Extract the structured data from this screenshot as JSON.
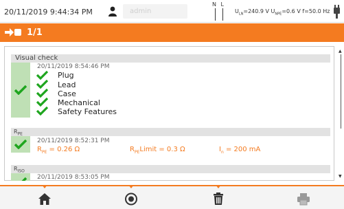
{
  "status": {
    "datetime": "20/11/2019 9:44:34 PM",
    "user_placeholder": "admin",
    "phase_labels": "N L",
    "voltage_html": "U<sub>LN</sub>=240.9 V U<sub>NPE</sub>=0.6 V f=50.0 Hz",
    "icons": {
      "user": "user-icon",
      "plug": "plug-icon"
    }
  },
  "titlebar": {
    "page": "1/1",
    "icon": "meter-probe-icon"
  },
  "sections": {
    "visual": {
      "title": "Visual check",
      "timestamp": "20/11/2019 8:54:46 PM",
      "items": [
        "Plug",
        "Lead",
        "Case",
        "Mechanical",
        "Safety Features"
      ]
    },
    "rpe": {
      "symbol_main": "R",
      "symbol_sub": "PE",
      "timestamp": "20/11/2019 8:52:31 PM",
      "value_label": "R",
      "value_sub": "PE",
      "value_text": " = 0.26 Ω",
      "limit_label": "R",
      "limit_sub": "PE",
      "limit_text": "Limit = 0.3 Ω",
      "current_label": "I",
      "current_sub": "n",
      "current_text": " = 200 mA"
    },
    "riso": {
      "symbol_main": "R",
      "symbol_sub": "ISO",
      "timestamp": "20/11/2019 8:53:05 PM"
    }
  },
  "bottombar": {
    "buttons": [
      "home-icon",
      "record-icon",
      "trash-icon",
      "print-icon"
    ]
  },
  "colors": {
    "accent": "#f47b20",
    "pass_green": "#1ea51e",
    "pass_column": "#bfe0b5"
  }
}
